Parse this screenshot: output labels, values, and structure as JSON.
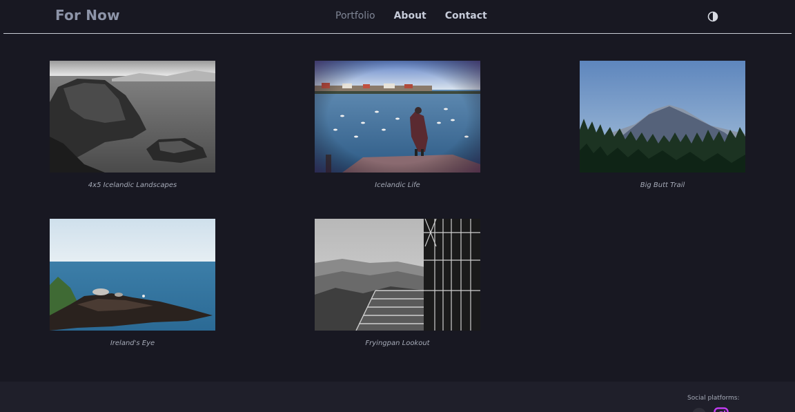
{
  "header": {
    "brand": "For Now",
    "nav": [
      {
        "label": "Portfolio",
        "active": true
      },
      {
        "label": "About",
        "active": false
      },
      {
        "label": "Contact",
        "active": false
      }
    ],
    "theme_toggle_icon": "half-circle-contrast-icon"
  },
  "gallery": {
    "items": [
      {
        "caption": "4x5 Icelandic Landscapes"
      },
      {
        "caption": "Icelandic Life"
      },
      {
        "caption": "Big Butt Trail"
      },
      {
        "caption": "Ireland's Eye"
      },
      {
        "caption": "Fryingpan Lookout"
      }
    ]
  },
  "footer": {
    "social_label": "Social platforms:",
    "social_icons": [
      "github-icon",
      "instagram-icon"
    ],
    "instagram_color": "#c13cf0"
  },
  "colors": {
    "background": "#181822",
    "footer_background": "#1f1f2a",
    "brand": "#8d94a8",
    "nav_link": "#c6cbd9",
    "nav_active": "#7f8595",
    "caption": "#a6abb8"
  }
}
